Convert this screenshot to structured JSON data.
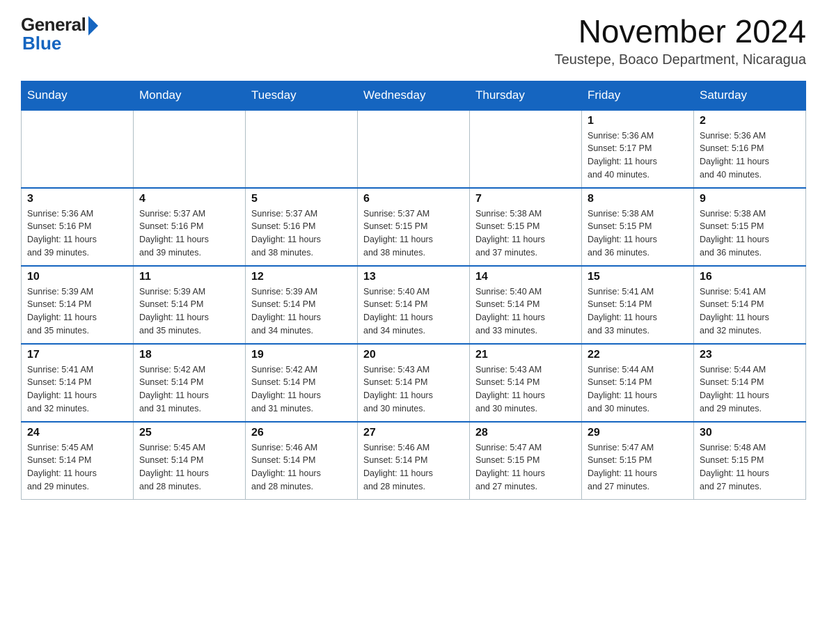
{
  "logo": {
    "general": "General",
    "blue": "Blue"
  },
  "title": "November 2024",
  "location": "Teustepe, Boaco Department, Nicaragua",
  "days_of_week": [
    "Sunday",
    "Monday",
    "Tuesday",
    "Wednesday",
    "Thursday",
    "Friday",
    "Saturday"
  ],
  "weeks": [
    [
      {
        "day": "",
        "info": ""
      },
      {
        "day": "",
        "info": ""
      },
      {
        "day": "",
        "info": ""
      },
      {
        "day": "",
        "info": ""
      },
      {
        "day": "",
        "info": ""
      },
      {
        "day": "1",
        "info": "Sunrise: 5:36 AM\nSunset: 5:17 PM\nDaylight: 11 hours\nand 40 minutes."
      },
      {
        "day": "2",
        "info": "Sunrise: 5:36 AM\nSunset: 5:16 PM\nDaylight: 11 hours\nand 40 minutes."
      }
    ],
    [
      {
        "day": "3",
        "info": "Sunrise: 5:36 AM\nSunset: 5:16 PM\nDaylight: 11 hours\nand 39 minutes."
      },
      {
        "day": "4",
        "info": "Sunrise: 5:37 AM\nSunset: 5:16 PM\nDaylight: 11 hours\nand 39 minutes."
      },
      {
        "day": "5",
        "info": "Sunrise: 5:37 AM\nSunset: 5:16 PM\nDaylight: 11 hours\nand 38 minutes."
      },
      {
        "day": "6",
        "info": "Sunrise: 5:37 AM\nSunset: 5:15 PM\nDaylight: 11 hours\nand 38 minutes."
      },
      {
        "day": "7",
        "info": "Sunrise: 5:38 AM\nSunset: 5:15 PM\nDaylight: 11 hours\nand 37 minutes."
      },
      {
        "day": "8",
        "info": "Sunrise: 5:38 AM\nSunset: 5:15 PM\nDaylight: 11 hours\nand 36 minutes."
      },
      {
        "day": "9",
        "info": "Sunrise: 5:38 AM\nSunset: 5:15 PM\nDaylight: 11 hours\nand 36 minutes."
      }
    ],
    [
      {
        "day": "10",
        "info": "Sunrise: 5:39 AM\nSunset: 5:14 PM\nDaylight: 11 hours\nand 35 minutes."
      },
      {
        "day": "11",
        "info": "Sunrise: 5:39 AM\nSunset: 5:14 PM\nDaylight: 11 hours\nand 35 minutes."
      },
      {
        "day": "12",
        "info": "Sunrise: 5:39 AM\nSunset: 5:14 PM\nDaylight: 11 hours\nand 34 minutes."
      },
      {
        "day": "13",
        "info": "Sunrise: 5:40 AM\nSunset: 5:14 PM\nDaylight: 11 hours\nand 34 minutes."
      },
      {
        "day": "14",
        "info": "Sunrise: 5:40 AM\nSunset: 5:14 PM\nDaylight: 11 hours\nand 33 minutes."
      },
      {
        "day": "15",
        "info": "Sunrise: 5:41 AM\nSunset: 5:14 PM\nDaylight: 11 hours\nand 33 minutes."
      },
      {
        "day": "16",
        "info": "Sunrise: 5:41 AM\nSunset: 5:14 PM\nDaylight: 11 hours\nand 32 minutes."
      }
    ],
    [
      {
        "day": "17",
        "info": "Sunrise: 5:41 AM\nSunset: 5:14 PM\nDaylight: 11 hours\nand 32 minutes."
      },
      {
        "day": "18",
        "info": "Sunrise: 5:42 AM\nSunset: 5:14 PM\nDaylight: 11 hours\nand 31 minutes."
      },
      {
        "day": "19",
        "info": "Sunrise: 5:42 AM\nSunset: 5:14 PM\nDaylight: 11 hours\nand 31 minutes."
      },
      {
        "day": "20",
        "info": "Sunrise: 5:43 AM\nSunset: 5:14 PM\nDaylight: 11 hours\nand 30 minutes."
      },
      {
        "day": "21",
        "info": "Sunrise: 5:43 AM\nSunset: 5:14 PM\nDaylight: 11 hours\nand 30 minutes."
      },
      {
        "day": "22",
        "info": "Sunrise: 5:44 AM\nSunset: 5:14 PM\nDaylight: 11 hours\nand 30 minutes."
      },
      {
        "day": "23",
        "info": "Sunrise: 5:44 AM\nSunset: 5:14 PM\nDaylight: 11 hours\nand 29 minutes."
      }
    ],
    [
      {
        "day": "24",
        "info": "Sunrise: 5:45 AM\nSunset: 5:14 PM\nDaylight: 11 hours\nand 29 minutes."
      },
      {
        "day": "25",
        "info": "Sunrise: 5:45 AM\nSunset: 5:14 PM\nDaylight: 11 hours\nand 28 minutes."
      },
      {
        "day": "26",
        "info": "Sunrise: 5:46 AM\nSunset: 5:14 PM\nDaylight: 11 hours\nand 28 minutes."
      },
      {
        "day": "27",
        "info": "Sunrise: 5:46 AM\nSunset: 5:14 PM\nDaylight: 11 hours\nand 28 minutes."
      },
      {
        "day": "28",
        "info": "Sunrise: 5:47 AM\nSunset: 5:15 PM\nDaylight: 11 hours\nand 27 minutes."
      },
      {
        "day": "29",
        "info": "Sunrise: 5:47 AM\nSunset: 5:15 PM\nDaylight: 11 hours\nand 27 minutes."
      },
      {
        "day": "30",
        "info": "Sunrise: 5:48 AM\nSunset: 5:15 PM\nDaylight: 11 hours\nand 27 minutes."
      }
    ]
  ]
}
